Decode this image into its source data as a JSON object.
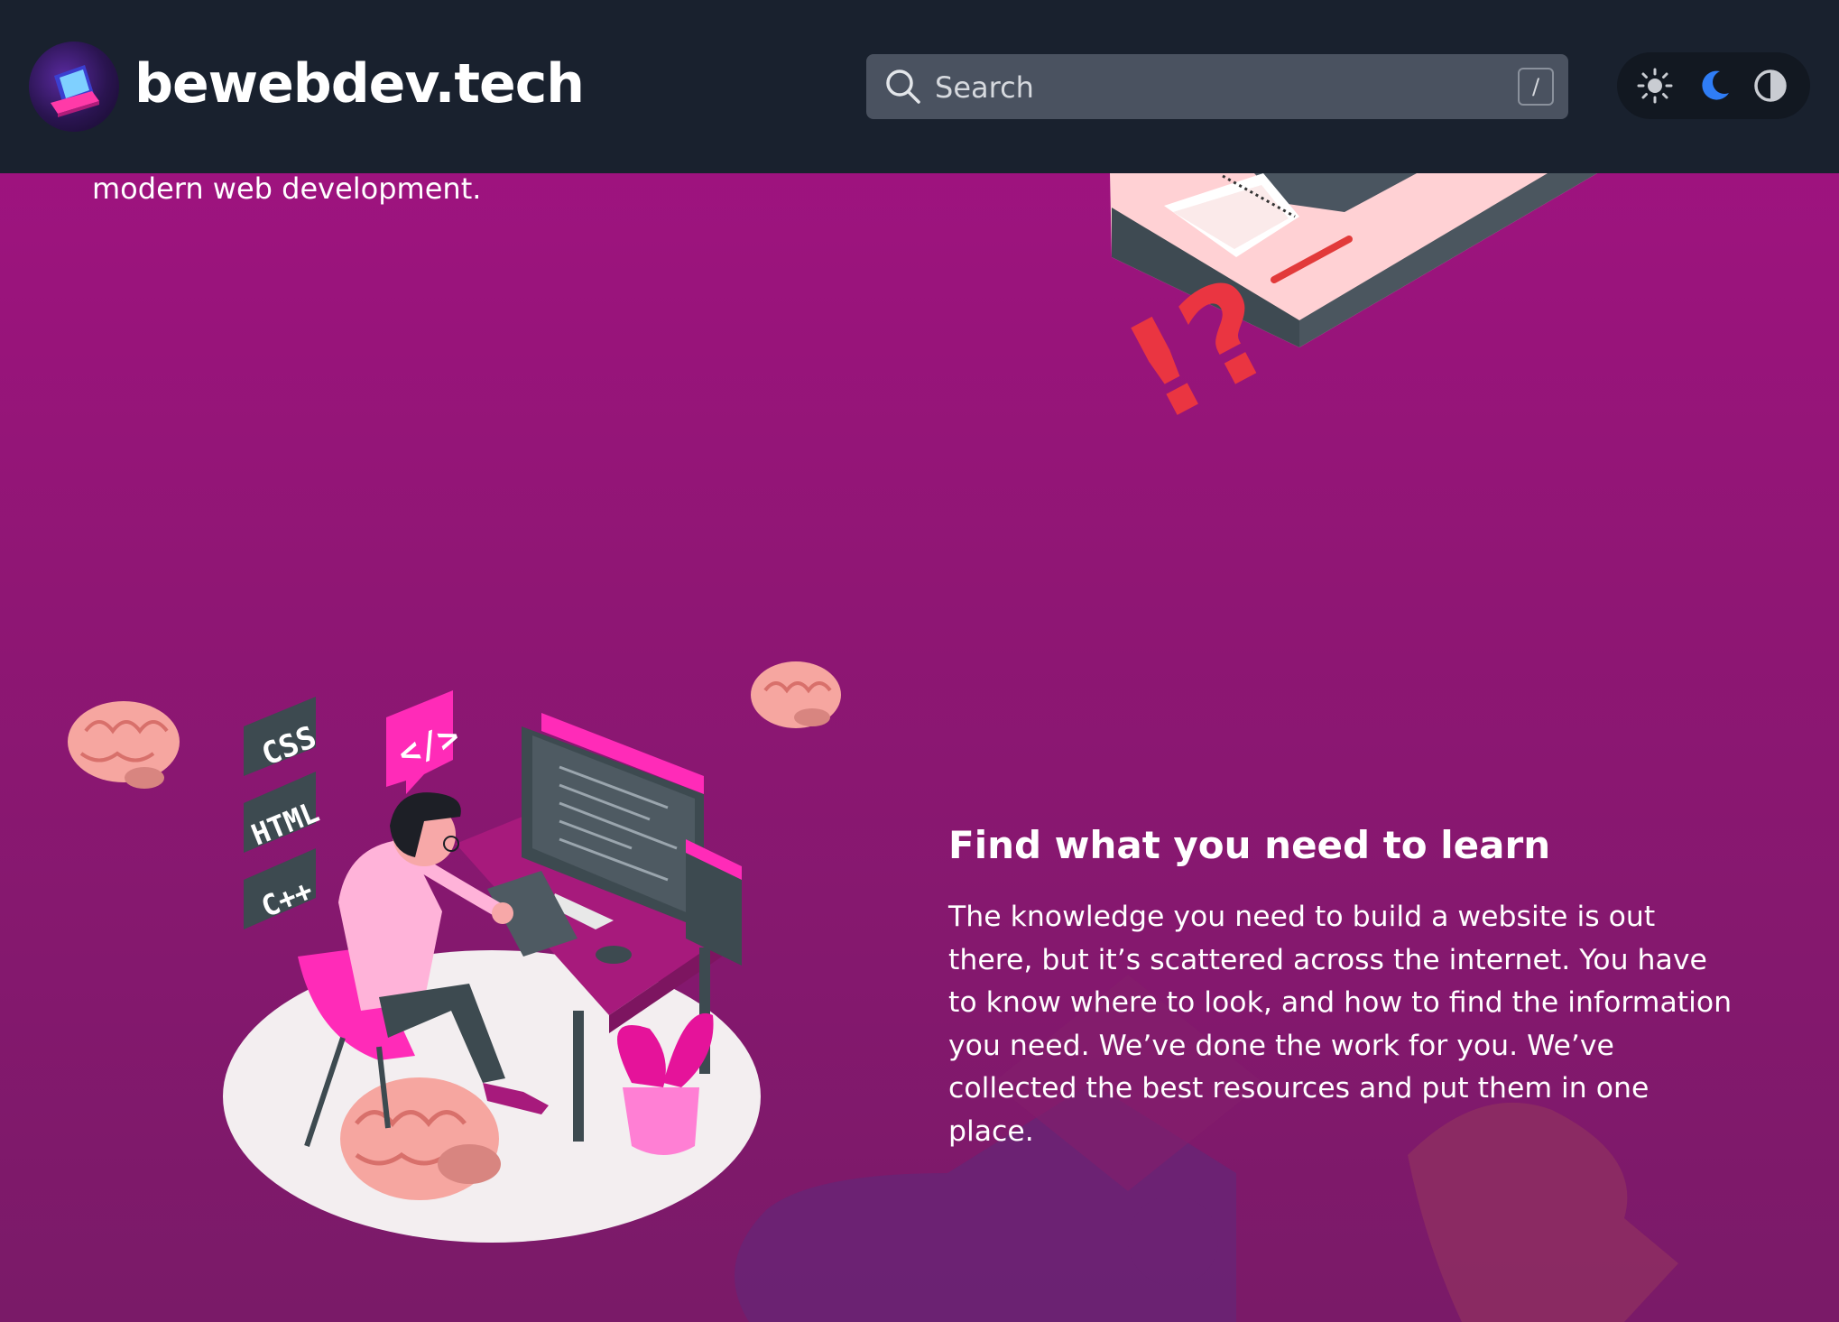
{
  "header": {
    "site_name": "bewebdev.tech",
    "search": {
      "placeholder": "Search",
      "shortcut": "/"
    },
    "theme_buttons": [
      "light",
      "dark",
      "system"
    ]
  },
  "hero": {
    "tail_text": "modern web development."
  },
  "section": {
    "heading": "Find what you need to learn",
    "body": "The knowledge you need to build a website is out there, but it’s scattered across the internet. You have to know where to look, and how to find the information you need. We’ve done the work for you. We’ve collected the best resources and put them in one place."
  },
  "illustration": {
    "tags": [
      "CSS",
      "HTML",
      "C++"
    ],
    "code_symbol": "</>"
  },
  "colors": {
    "header_bg": "#19212e",
    "page_bg": "#a41283",
    "accent_moon": "#2f7df6",
    "pink": "#ff2bb8"
  }
}
